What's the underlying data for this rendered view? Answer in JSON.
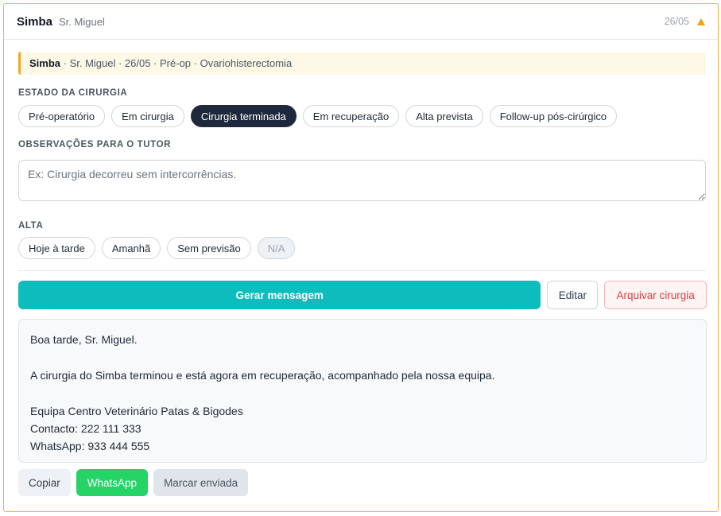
{
  "header": {
    "patient_name": "Simba",
    "owner_name": "Sr. Miguel",
    "date": "26/05"
  },
  "banner": {
    "patient_name": "Simba",
    "details": " · Sr. Miguel · 26/05 · Pré-op · Ovariohisterectomia"
  },
  "surgery_state": {
    "label": "ESTADO DA CIRURGIA",
    "options": [
      "Pré-operatório",
      "Em cirurgia",
      "Cirurgia terminada",
      "Em recuperação",
      "Alta prevista",
      "Follow-up pós-cirúrgico"
    ],
    "selected": "Cirurgia terminada"
  },
  "observations": {
    "label": "OBSERVAÇÕES PARA O TUTOR",
    "value": "",
    "placeholder": "Ex: Cirurgia decorreu sem intercorrências."
  },
  "discharge": {
    "label": "ALTA",
    "options": [
      "Hoje à tarde",
      "Amanhã",
      "Sem previsão",
      "N/A"
    ],
    "selected": "N/A"
  },
  "actions": {
    "generate_label": "Gerar mensagem",
    "edit_label": "Editar",
    "archive_label": "Arquivar cirurgia"
  },
  "message": {
    "lines": [
      "Boa tarde, Sr. Miguel.",
      "",
      "A cirurgia do Simba terminou e está agora em recuperação, acompanhado pela nossa equipa.",
      "",
      "Equipa Centro Veterinário Patas & Bigodes",
      "Contacto: 222 111 333",
      "WhatsApp: 933 444 555"
    ]
  },
  "bottom_actions": {
    "copy_label": "Copiar",
    "whatsapp_label": "WhatsApp",
    "mark_sent_label": "Marcar enviada"
  },
  "colors": {
    "accent": "#0dbdbd",
    "card_border": "#f0b34a",
    "whatsapp": "#25d366",
    "danger": "#dc3f3f",
    "chip_active": "#1e2a3b"
  },
  "icons": {
    "collapse": "triangle-up-icon"
  }
}
